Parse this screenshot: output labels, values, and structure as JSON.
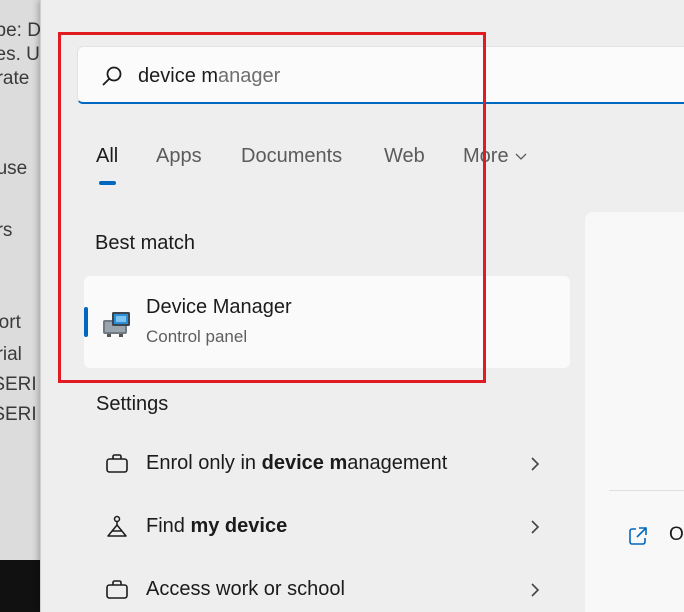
{
  "background_doc": {
    "lines": [
      "ype: Dri",
      "ces. U",
      "arate",
      "ouse",
      "ers",
      "Port",
      "erial",
      "-SERI",
      "-SERI"
    ]
  },
  "search": {
    "query_typed": "device m",
    "query_suggested": "anager"
  },
  "tabs": {
    "all": "All",
    "apps": "Apps",
    "documents": "Documents",
    "web": "Web",
    "more": "More"
  },
  "best_match": {
    "heading": "Best match",
    "title_pre": "Device M",
    "title_post": "anager",
    "subtitle": "Control panel",
    "icon": "device-manager-icon"
  },
  "settings": {
    "heading": "Settings",
    "items": [
      {
        "pre": "Enrol only in ",
        "bold": "device m",
        "post": "anagement",
        "icon": "briefcase-icon"
      },
      {
        "pre": "Find ",
        "bold": "my device",
        "post": "",
        "icon": "find-device-icon"
      },
      {
        "pre": "Access work or school",
        "bold": "",
        "post": "",
        "icon": "briefcase-icon"
      }
    ]
  },
  "preview": {
    "action_label": "Op"
  },
  "colors": {
    "accent": "#0067c0",
    "highlight": "#e21a22"
  }
}
